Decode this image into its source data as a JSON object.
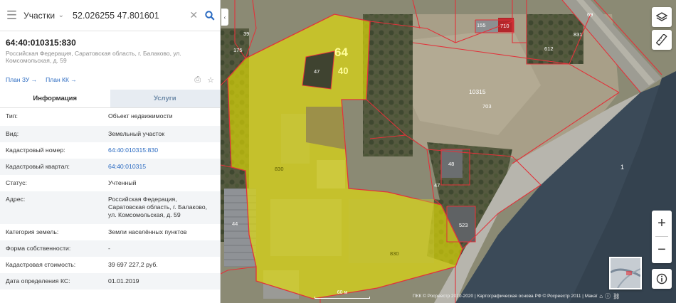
{
  "search": {
    "layer": "Участки",
    "value": "52.026255 47.801601"
  },
  "parcel": {
    "number": "64:40:010315:830",
    "address": "Российская Федерация, Саратовская область, г. Балаково, ул. Комсомольская, д. 59"
  },
  "plans": {
    "zu": "План ЗУ →",
    "kk": "План КК →"
  },
  "tabs": {
    "info": "Информация",
    "services": "Услуги"
  },
  "info": [
    {
      "label": "Тип:",
      "value": "Объект недвижимости",
      "link": false
    },
    {
      "label": "Вид:",
      "value": "Земельный участок",
      "link": false
    },
    {
      "label": "Кадастровый номер:",
      "value": "64:40:010315:830",
      "link": true
    },
    {
      "label": "Кадастровый квартал:",
      "value": "64:40:010315",
      "link": true
    },
    {
      "label": "Статус:",
      "value": "Учтенный",
      "link": false
    },
    {
      "label": "Адрес:",
      "value": "Российская Федерация, Саратовская область, г. Балаково, ул. Комсомольская, д. 59",
      "link": false
    },
    {
      "label": "Категория земель:",
      "value": "Земли населённых пунктов",
      "link": false
    },
    {
      "label": "Форма собственности:",
      "value": "-",
      "link": false
    },
    {
      "label": "Кадастровая стоимость:",
      "value": "39 697 227,2 руб.",
      "link": false
    },
    {
      "label": "Дата определения КС:",
      "value": "01.01.2019",
      "link": false
    }
  ],
  "map_labels": {
    "big_64": "64",
    "big_40": "40",
    "l47": "47",
    "l830": "830",
    "l830b": "830",
    "l10315": "10315",
    "l703": "703",
    "l48": "48",
    "l47b": "47",
    "l523": "523",
    "l1": "1",
    "l175": "175",
    "l39": "39",
    "l155": "155",
    "l710": "710",
    "l69": "69",
    "l831": "831",
    "l612": "612",
    "l44": "44"
  },
  "scale": "60 м",
  "footer": {
    "copyright": "ПКК © Росреестр 2010-2020 | Картографическая основа РФ © Росреестр 2011 | Макаї"
  },
  "colors": {
    "accent": "#2a6ac1",
    "parcel_fill": "#e8e400",
    "boundary": "#e2323a"
  }
}
